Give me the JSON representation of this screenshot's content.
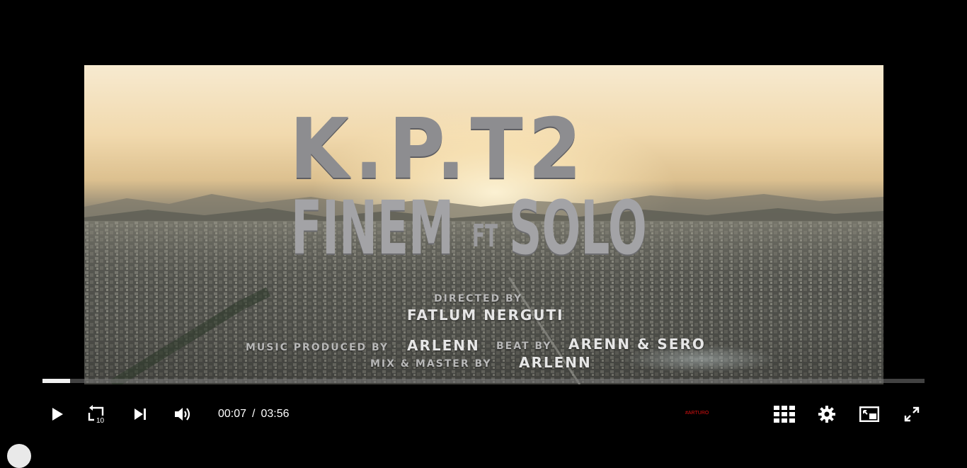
{
  "video": {
    "title_line1": "K.P.T2",
    "artist1": "FINEM",
    "ft": "FT",
    "artist2": "SOLO",
    "directed_label": "DIRECTED BY",
    "director": "FATLUM NERGUTI",
    "music_label": "MUSIC PRODUCED BY",
    "music_producer": "ARLENN",
    "beat_label": "BEAT BY",
    "beat_makers": "ARENN & SERO",
    "mix_label": "MIX & MASTER BY",
    "mix_engineer": "ARLENN"
  },
  "player": {
    "current_time": "00:07",
    "separator": "/",
    "duration": "03:56",
    "progress_fraction": 0.031,
    "brand_text": "#ARTURO",
    "colors": {
      "progress": "#f0f0f0",
      "track": "#787878",
      "brand": "#dd1111"
    },
    "icons": [
      "play-icon",
      "rewind-10-icon",
      "next-icon",
      "volume-icon",
      "grid-icon",
      "settings-icon",
      "miniplayer-icon",
      "fullscreen-icon"
    ],
    "rewind_seconds": "10"
  }
}
